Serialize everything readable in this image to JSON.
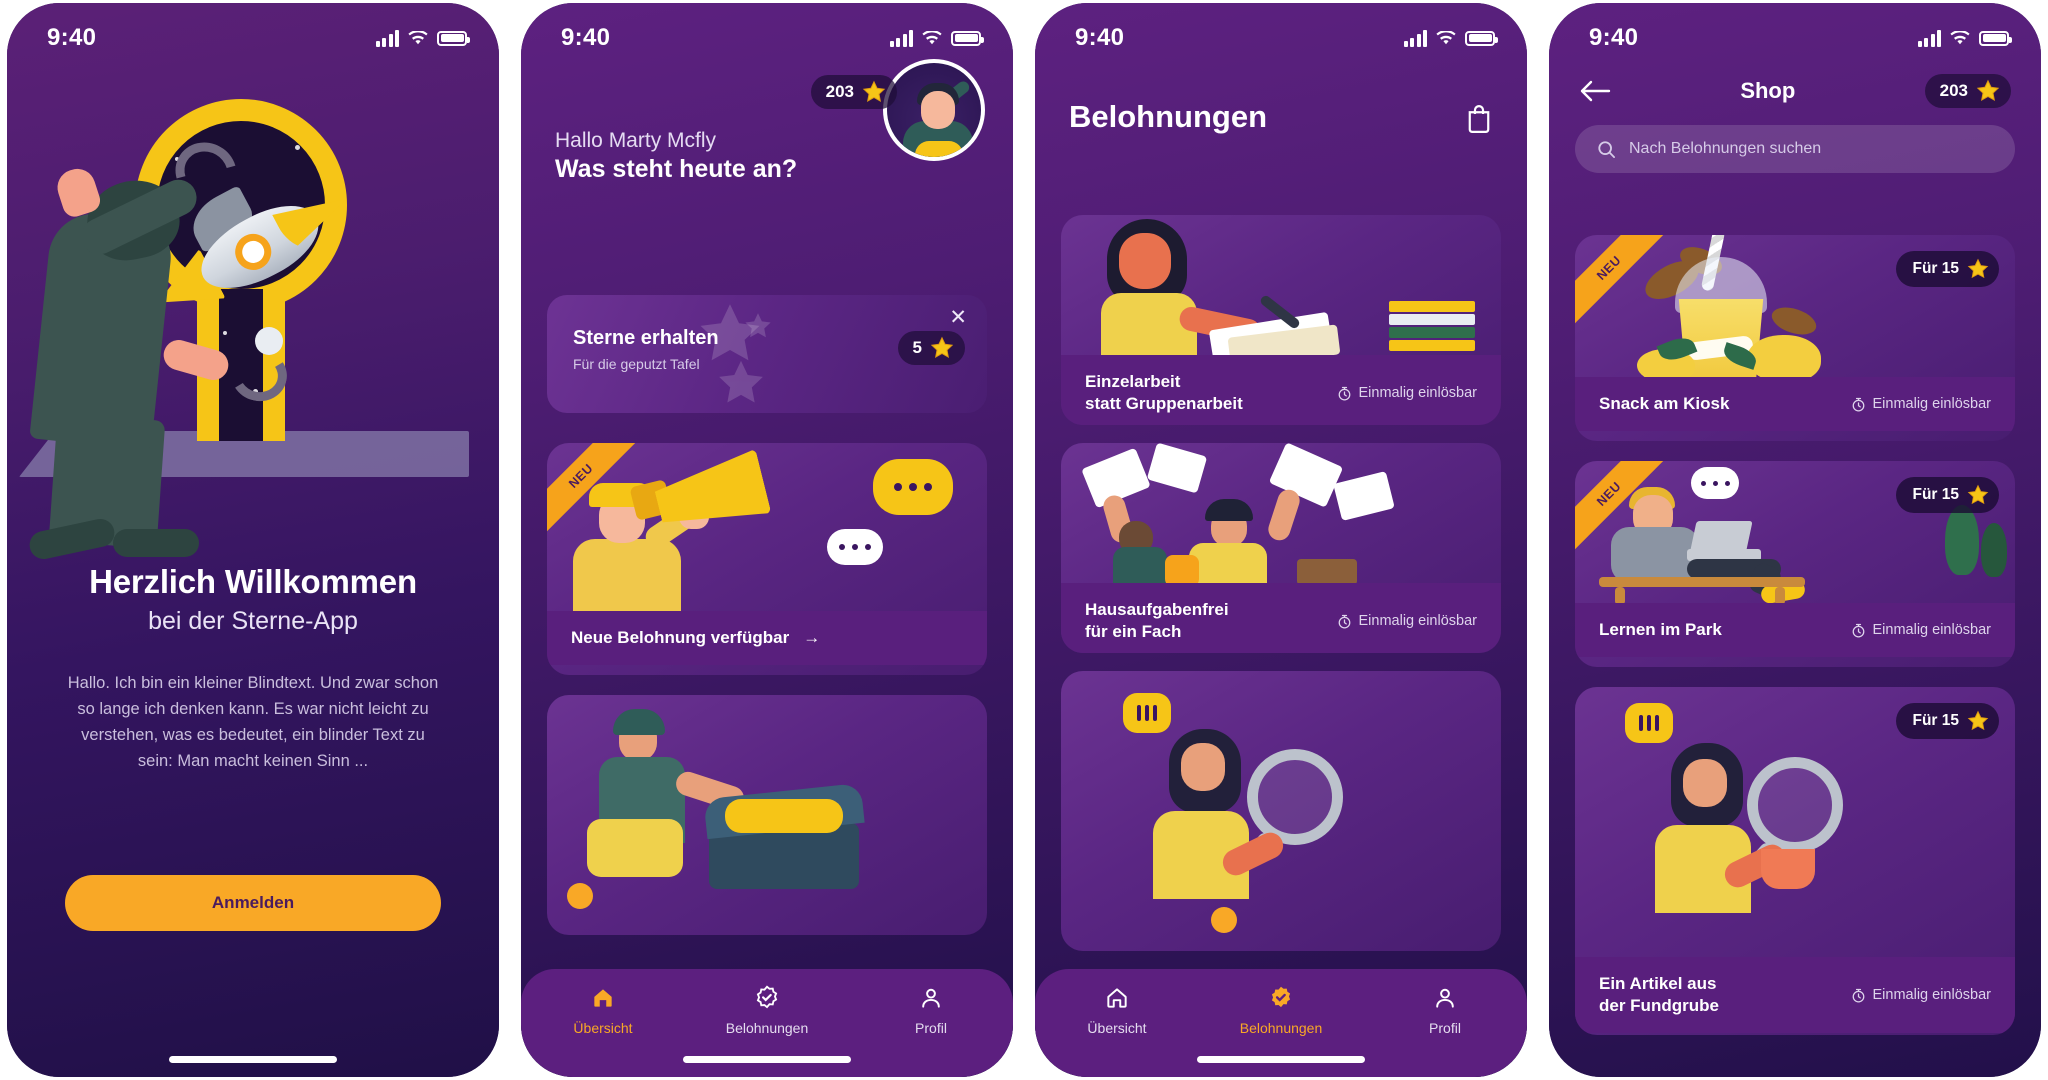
{
  "colors": {
    "brand_purple": "#5c1f7f",
    "deep_purple": "#22104a",
    "accent_yellow": "#F9A826",
    "star_gold": "#F6C517",
    "card_purple": "#591f7d",
    "text_light": "#ffffff",
    "text_muted": "#d6cbe8"
  },
  "status_bar": {
    "time": "9:40",
    "signal_icon": "signal-bars-icon",
    "wifi_icon": "wifi-icon",
    "battery_icon": "battery-full-icon"
  },
  "screen1": {
    "illustration": "person-with-keyhole-rocket-illustration",
    "title": "Herzlich Willkommen",
    "subtitle": "bei der Sterne-App",
    "paragraph": "Hallo. Ich bin ein kleiner Blindtext. Und zwar schon so lange ich denken kann. Es war nicht leicht zu verstehen, was es bedeutet, ein blinder Text zu sein: Man macht keinen Sinn ...",
    "primary_button": "Anmelden"
  },
  "screen2": {
    "greeting": "Hallo Marty Mcfly",
    "question": "Was steht heute an?",
    "star_count": "203",
    "star_icon": "star-icon",
    "avatar": "user-avatar-popcorn",
    "star_card": {
      "title": "Sterne erhalten",
      "subtitle": "Für die geputzt Tafel",
      "amount": "5",
      "star_icon": "star-icon",
      "close_icon": "close-icon"
    },
    "reward_card": {
      "ribbon": "NEU",
      "title": "Neue Belohnung verfügbar",
      "arrow": "→",
      "illustration": "kid-with-megaphone-illustration"
    },
    "second_card": {
      "illustration": "kid-with-treasure-chest-illustration"
    },
    "nav": [
      {
        "label": "Übersicht",
        "icon": "home-icon",
        "active": true
      },
      {
        "label": "Belohnungen",
        "icon": "badge-check-icon",
        "active": false
      },
      {
        "label": "Profil",
        "icon": "person-icon",
        "active": false
      }
    ]
  },
  "screen3": {
    "title": "Belohnungen",
    "bag_icon": "shopping-bag-icon",
    "cards": [
      {
        "title_line1": "Einzelarbeit",
        "title_line2": "statt Gruppenarbeit",
        "meta": "Einmalig einlösbar",
        "clock_icon": "stopwatch-icon",
        "illustration": "teacher-with-notebook-illustration"
      },
      {
        "title_line1": "Hausaufgabenfrei",
        "title_line2": "für ein Fach",
        "meta": "Einmalig einlösbar",
        "clock_icon": "stopwatch-icon",
        "illustration": "kids-throwing-papers-illustration"
      },
      {
        "title_line1": "",
        "title_line2": "",
        "meta": "",
        "clock_icon": "stopwatch-icon",
        "illustration": "girl-with-magnifier-illustration"
      }
    ],
    "nav": [
      {
        "label": "Übersicht",
        "icon": "home-icon",
        "active": false
      },
      {
        "label": "Belohnungen",
        "icon": "badge-check-icon",
        "active": true
      },
      {
        "label": "Profil",
        "icon": "person-icon",
        "active": false
      }
    ]
  },
  "screen4": {
    "back_icon": "arrow-left-icon",
    "title": "Shop",
    "star_count": "203",
    "star_icon": "star-icon",
    "search_placeholder": "Nach Belohnungen suchen",
    "search_icon": "search-icon",
    "items": [
      {
        "ribbon": "NEU",
        "price": "Für 15",
        "star_icon": "star-icon",
        "title": "Snack am Kiosk",
        "meta": "Einmalig einlösbar",
        "clock_icon": "stopwatch-icon",
        "illustration": "slush-drink-with-mangos-illustration"
      },
      {
        "ribbon": "NEU",
        "price": "Für 15",
        "star_icon": "star-icon",
        "title": "Lernen im Park",
        "meta": "Einmalig einlösbar",
        "clock_icon": "stopwatch-icon",
        "illustration": "boy-on-bench-with-laptop-illustration"
      },
      {
        "ribbon": "",
        "price": "Für 15",
        "star_icon": "star-icon",
        "title_line1": "Ein Artikel aus",
        "title_line2": "der Fundgrube",
        "meta": "Einmalig einlösbar",
        "clock_icon": "stopwatch-icon",
        "illustration": "girl-with-magnifier-illustration"
      }
    ]
  }
}
